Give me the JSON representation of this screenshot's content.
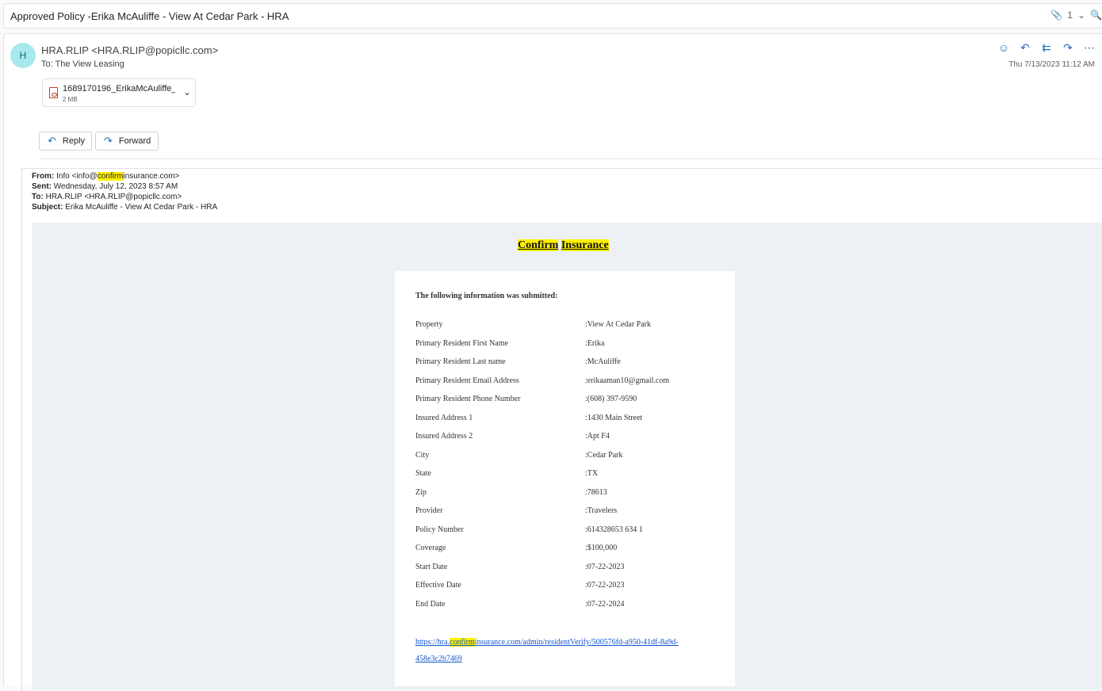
{
  "subject": "Approved Policy -Erika McAuliffe - View At Cedar Park - HRA",
  "top": {
    "attachment_count": "1"
  },
  "message": {
    "avatar_initial": "H",
    "sender": "HRA.RLIP <HRA.RLIP@popicllc.com>",
    "to_label": "To:",
    "to_value": "The View Leasing",
    "date": "Thu 7/13/2023 11:12 AM",
    "attachment": {
      "name": "1689170196_ErikaMcAuliffe_...",
      "size": "2 MB"
    },
    "reply_label": "Reply",
    "forward_label": "Forward"
  },
  "quoted": {
    "from_label": "From:",
    "from_pre": "Info <info@",
    "from_hl": "confirm",
    "from_post": "insurance.com>",
    "sent_label": "Sent:",
    "sent_value": "Wednesday, July 12, 2023 8:57 AM",
    "to_label": "To:",
    "to_value": "HRA.RLIP <HRA.RLIP@popicllc.com>",
    "subject_label": "Subject:",
    "subject_value": "Erika McAuliffe - View At Cedar Park - HRA"
  },
  "body": {
    "title_word1": "Confirm",
    "title_word2": "Insurance",
    "submitted": "The following information was submitted:",
    "rows": [
      {
        "label": "Property",
        "value": ":View At Cedar Park"
      },
      {
        "label": "Primary Resident First Name",
        "value": ":Erika"
      },
      {
        "label": "Primary Resident Last name",
        "value": ":McAuliffe"
      },
      {
        "label": "Primary Resident Email Address",
        "value": ":erikaaman10@gmail.com"
      },
      {
        "label": "Primary Resident Phone Number",
        "value": ":(608) 397-9590"
      },
      {
        "label": "Insured Address 1",
        "value": ":1430 Main Street"
      },
      {
        "label": "Insured Address 2",
        "value": ":Apt F4"
      },
      {
        "label": "City",
        "value": ":Cedar Park"
      },
      {
        "label": "State",
        "value": ":TX"
      },
      {
        "label": "Zip",
        "value": ":78613"
      },
      {
        "label": "Provider",
        "value": ":Travelers"
      },
      {
        "label": "Policy Number",
        "value": ":614328653 634 1"
      },
      {
        "label": "Coverage",
        "value": ":$100,000"
      },
      {
        "label": "Start Date",
        "value": ":07-22-2023"
      },
      {
        "label": "Effective Date",
        "value": ":07-22-2023"
      },
      {
        "label": "End Date",
        "value": ":07-22-2024"
      }
    ],
    "link_pre": "https://hra.",
    "link_hl": "confirm",
    "link_post": "insurance.com/admin/residentVerify/500576fd-a950-41df-8a9d-458e3c2b7469"
  }
}
